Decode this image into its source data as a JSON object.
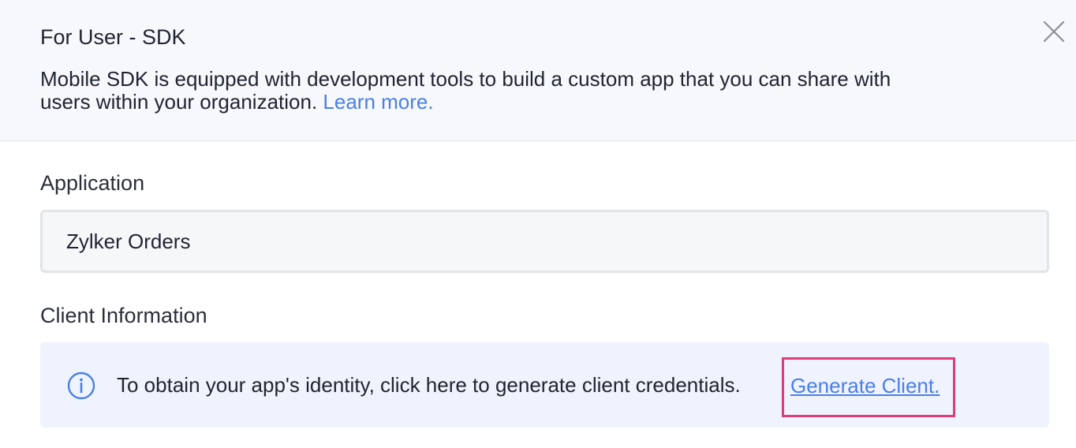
{
  "dialog": {
    "title": "For User - SDK",
    "description": "Mobile SDK is equipped with development tools to build a custom app that you can share with users within your organization.",
    "learn_more_label": "Learn more.",
    "application": {
      "label": "Application",
      "value": "Zylker Orders"
    },
    "client_info": {
      "label": "Client Information",
      "message": "To obtain your app's identity, click here to generate client credentials.",
      "generate_link_label": "Generate Client."
    }
  },
  "icons": {
    "close": "close-icon",
    "info": "info-icon"
  },
  "colors": {
    "link": "#4a7fe8",
    "highlight_border": "#e03a78",
    "header_bg": "#f7f8fb",
    "info_bg": "#eff3fd"
  }
}
